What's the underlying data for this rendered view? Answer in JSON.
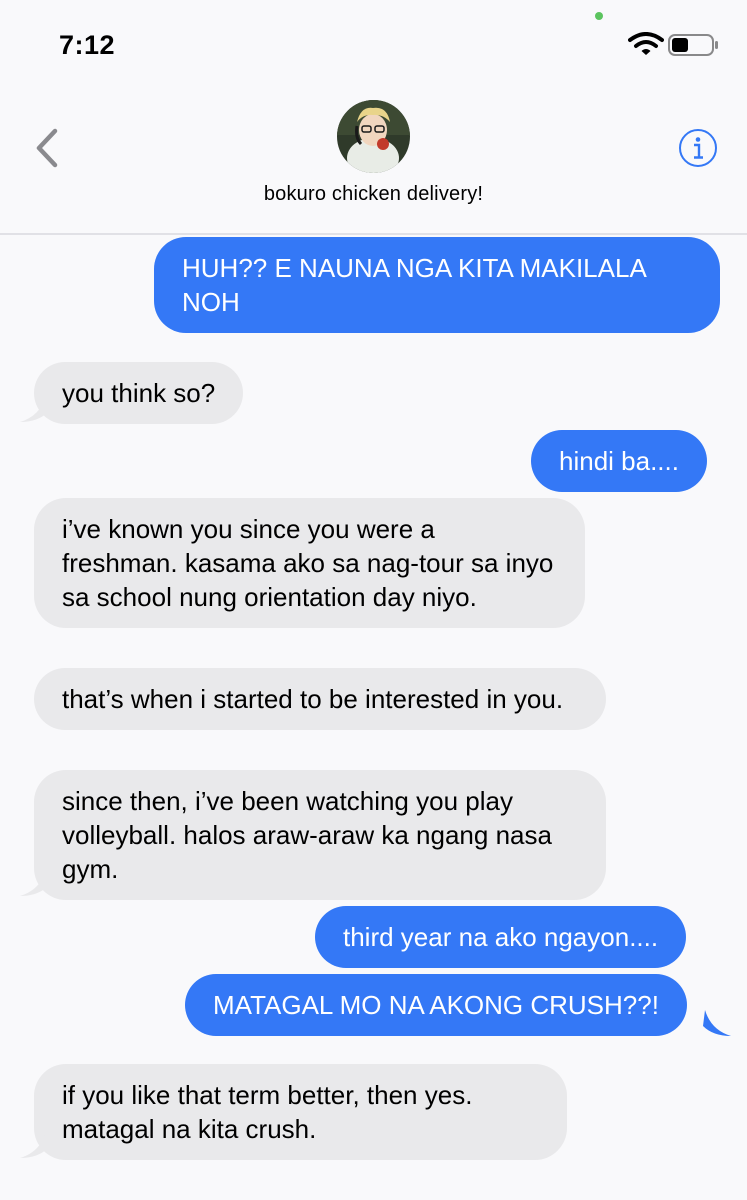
{
  "status": {
    "time": "7:12"
  },
  "header": {
    "contact_name": "bokuro chicken delivery!",
    "info_icon": "info-icon",
    "back_icon": "chevron-left-icon"
  },
  "colors": {
    "sent": "#3478f6",
    "received": "#e9e9eb",
    "accent": "#3478f6"
  },
  "messages": [
    {
      "from": "me",
      "text": "HUH?? E NAUNA NGA KITA MAKILALA NOH"
    },
    {
      "from": "them",
      "text": "you think so?"
    },
    {
      "from": "me",
      "text": "hindi ba...."
    },
    {
      "from": "them",
      "text": "i’ve known you since you were a freshman. kasama ako sa nag-tour sa inyo sa school nung orientation day niyo."
    },
    {
      "from": "them",
      "text": "that’s when i started to be interested in you."
    },
    {
      "from": "them",
      "text": "since then, i’ve been watching you play volleyball. halos araw-araw ka ngang nasa gym."
    },
    {
      "from": "me",
      "text": "third year na ako ngayon...."
    },
    {
      "from": "me",
      "text": "MATAGAL MO NA AKONG CRUSH??!"
    },
    {
      "from": "them",
      "text": "if you like that term better, then yes. matagal na kita crush."
    }
  ]
}
